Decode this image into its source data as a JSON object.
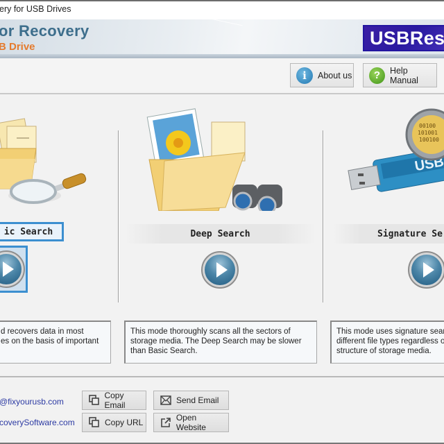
{
  "window": {
    "title": "ery for USB Drives"
  },
  "banner": {
    "app_name": "or Recovery",
    "app_sub": "B Drive",
    "logo_text": "USBRes"
  },
  "toolbar": {
    "about": {
      "label": "About us",
      "icon": "info-icon",
      "color": "#2279b3"
    },
    "help": {
      "label": "Help Manual",
      "icon": "help-icon",
      "color": "#3f9417"
    }
  },
  "modes": [
    {
      "label": "ic Search",
      "full_name": "Basic Search",
      "selected": true,
      "description": "d recovers data in most\nes on the basis of important",
      "icon": "folder-magnifier-icon"
    },
    {
      "label": "Deep Search",
      "selected": false,
      "description": "This mode thoroughly scans all the sectors of storage media. The Deep Search may be slower than Basic Search.",
      "icon": "folder-binoculars-icon"
    },
    {
      "label": "Signature Se",
      "full_name": "Signature Search",
      "selected": false,
      "description": "This mode uses signature searc different file types regardless o structure of storage media.",
      "icon": "usb-drive-icon"
    }
  ],
  "footer": {
    "email": "@fixyourusb.com",
    "website": "coverySoftware.com",
    "copy_email": "Copy Email",
    "send_email": "Send Email",
    "copy_url": "Copy URL",
    "open_website": "Open Website"
  },
  "colors": {
    "accent": "#3c8fd0",
    "link": "#2c3aa3",
    "brand_title": "#3d6e8c",
    "brand_sub": "#e47b2e",
    "logo_bg": "#2a1aa0"
  }
}
